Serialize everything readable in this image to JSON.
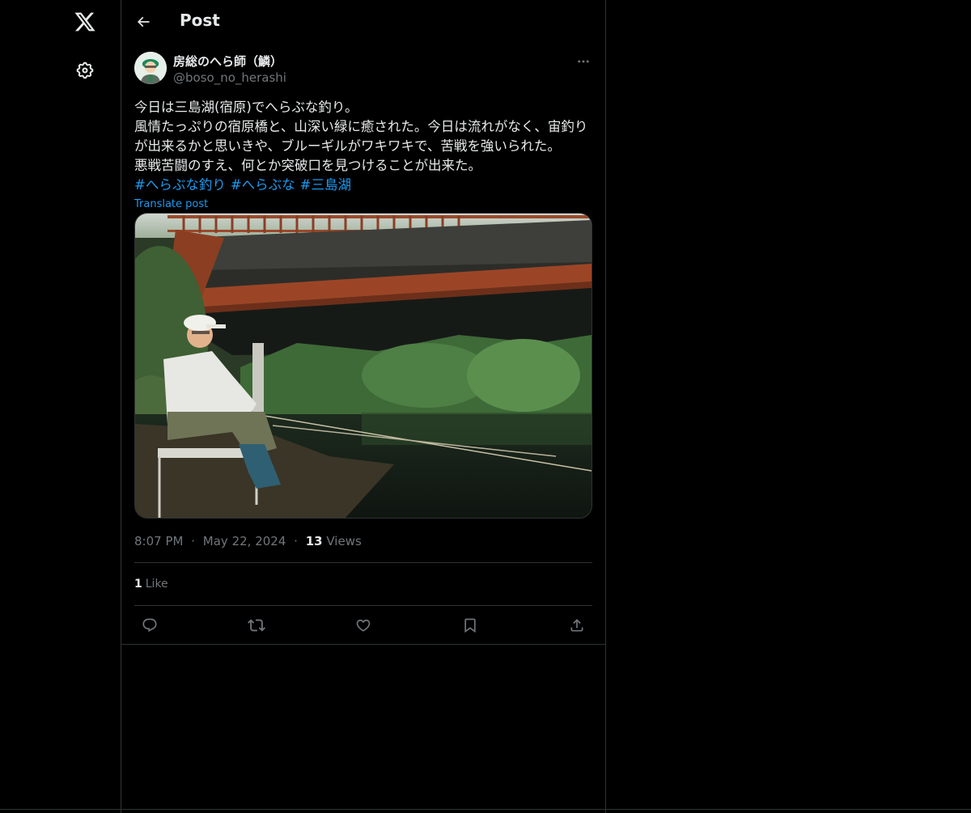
{
  "header": {
    "title": "Post"
  },
  "icons": {
    "logo": "x-logo-icon",
    "settings": "gear-icon",
    "back": "arrow-left-icon",
    "more": "more-horizontal-icon",
    "reply": "reply-icon",
    "repost": "repost-icon",
    "like": "heart-icon",
    "bookmark": "bookmark-icon",
    "share": "share-icon"
  },
  "post": {
    "author": {
      "display_name": "房総のへら師（鱗）",
      "handle": "@boso_no_herashi"
    },
    "text": "今日は三島湖(宿原)でへらぶな釣り。\n風情たっぷりの宿原橋と、山深い緑に癒された。今日は流れがなく、宙釣りが出来るかと思いきや、ブルーギルがワキワキで、苦戦を強いられた。\n悪戦苦闘のすえ、何とか突破口を見つけることが出来た。",
    "hashtags": [
      "#へらぶな釣り",
      "#へらぶな",
      "#三島湖"
    ],
    "translate_label": "Translate post",
    "time": "8:07 PM",
    "separator": "·",
    "date": "May 22, 2024",
    "views_count": "13",
    "views_label": "Views",
    "likes_count": "1",
    "likes_label": "Like"
  },
  "colors": {
    "background": "#000000",
    "text": "#e7e9ea",
    "secondary": "#71767b",
    "accent": "#1d9bf0",
    "border": "#2f3336"
  }
}
